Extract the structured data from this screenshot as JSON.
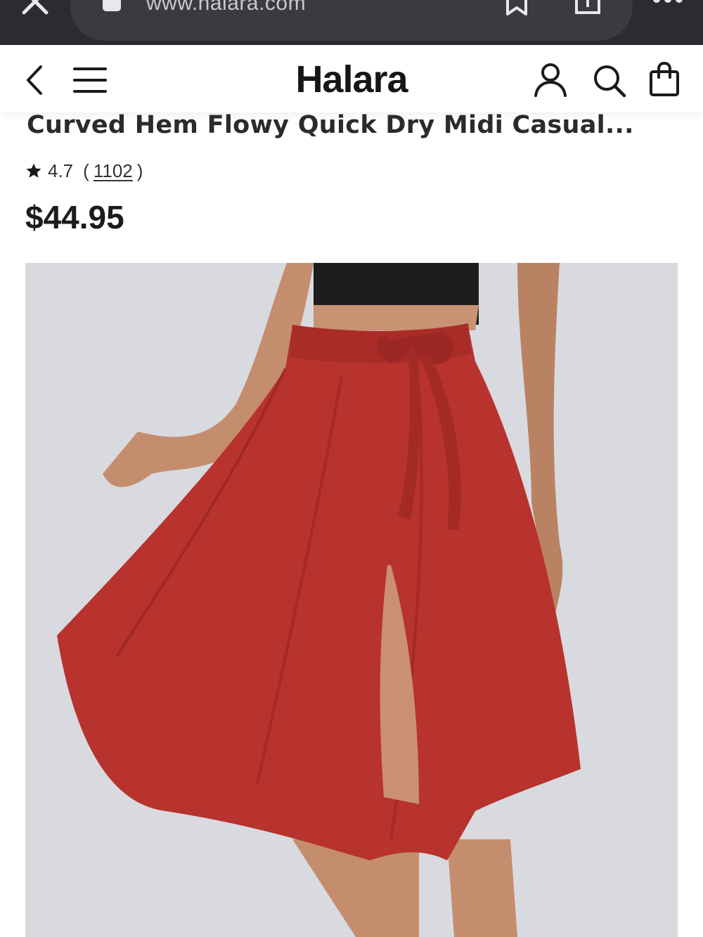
{
  "browser": {
    "url": "www.halara.com"
  },
  "header": {
    "brand": "Halara"
  },
  "product": {
    "title": "Curved Hem Flowy Quick Dry Midi Casual...",
    "rating": "4.7",
    "rating_open": "(",
    "review_count": "1102",
    "rating_close": ")",
    "price": "$44.95",
    "image": {
      "subject": "model wearing red tie-waist midi skirt with front slit and black crop top",
      "background_color": "#d9dadf",
      "skirt_color": "#b8322e"
    }
  },
  "colors": {
    "browser_bar": "#2b2c31",
    "url_pill": "#3a3b41",
    "text": "#222222"
  },
  "icons": {
    "close": "close-icon",
    "lock": "lock-icon",
    "bookmark": "bookmark-icon",
    "share": "share-icon",
    "more": "more-icon",
    "back": "back-icon",
    "menu": "hamburger-menu-icon",
    "account": "account-icon",
    "search": "search-icon",
    "bag": "shopping-bag-icon",
    "star": "star-icon"
  }
}
